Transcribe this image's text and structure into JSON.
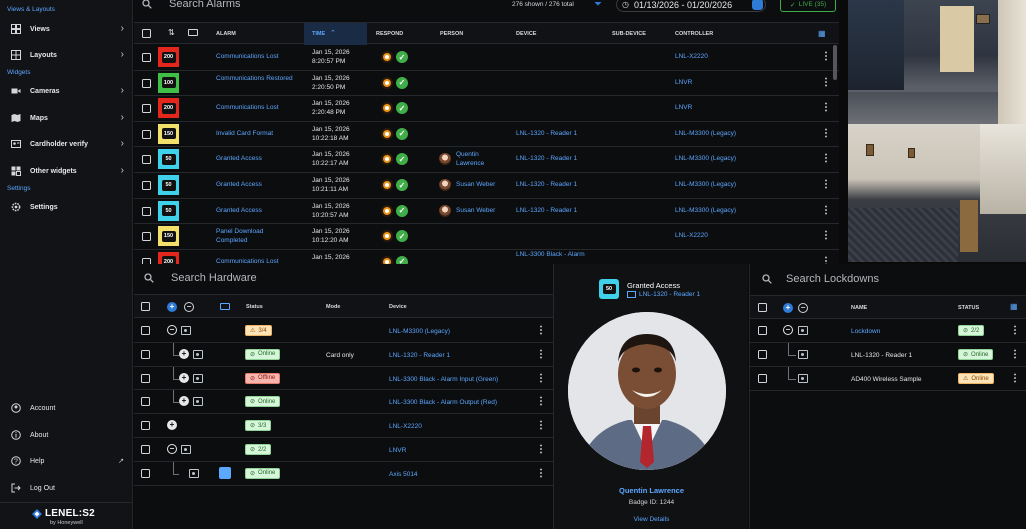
{
  "sidebar": {
    "sections": {
      "views": "Views & Layouts",
      "widgets": "Widgets",
      "settings": "Settings"
    },
    "items": [
      {
        "label": "Views",
        "icon": "views-grid-icon"
      },
      {
        "label": "Layouts",
        "icon": "layouts-icon"
      },
      {
        "label": "Cameras",
        "icon": "camera-icon"
      },
      {
        "label": "Maps",
        "icon": "map-icon"
      },
      {
        "label": "Cardholder verify",
        "icon": "id-card-icon"
      },
      {
        "label": "Other widgets",
        "icon": "widgets-icon"
      },
      {
        "label": "Settings",
        "icon": "gear-icon"
      }
    ],
    "bottom": [
      {
        "label": "Account",
        "icon": "account-icon"
      },
      {
        "label": "About",
        "icon": "info-icon"
      },
      {
        "label": "Help",
        "icon": "help-icon"
      },
      {
        "label": "Log Out",
        "icon": "logout-icon"
      }
    ],
    "brand": {
      "name": "LENEL:S2",
      "sub": "by Honeywell"
    }
  },
  "alarms": {
    "search_placeholder": "Search Alarms",
    "shown_count": "276 shown / 276 total",
    "date_range": "01/13/2026 - 01/20/2026",
    "live_label": "LIVE (35)",
    "columns": {
      "alarm": "ALARM",
      "time": "TIME",
      "respond": "RESPOND",
      "person": "PERSON",
      "device": "DEVICE",
      "subdevice": "SUB-DEVICE",
      "controller": "CONTROLLER"
    },
    "rows": [
      {
        "priority": "200",
        "color": "#e3271c",
        "alarm": "Communications Lost",
        "date": "Jan 15, 2026",
        "time": "8:20:57 PM",
        "person": "",
        "device": "",
        "controller": "LNL-X2220"
      },
      {
        "priority": "100",
        "color": "#3fbf46",
        "alarm": "Communications Restored",
        "date": "Jan 15, 2026",
        "time": "2:20:50 PM",
        "person": "",
        "device": "",
        "controller": "LNVR"
      },
      {
        "priority": "200",
        "color": "#e3271c",
        "alarm": "Communications Lost",
        "date": "Jan 15, 2026",
        "time": "2:20:48 PM",
        "person": "",
        "device": "",
        "controller": "LNVR"
      },
      {
        "priority": "150",
        "color": "#f3e06a",
        "alarm": "Invalid Card Format",
        "date": "Jan 15, 2026",
        "time": "10:22:18 AM",
        "person": "",
        "device": "LNL-1320 - Reader 1",
        "controller": "LNL-M3300 (Legacy)"
      },
      {
        "priority": "50",
        "color": "#3fd0ea",
        "alarm": "Granted Access",
        "date": "Jan 15, 2026",
        "time": "10:22:17 AM",
        "person": "Quentin Lawrence",
        "device": "LNL-1320 - Reader 1",
        "controller": "LNL-M3300 (Legacy)"
      },
      {
        "priority": "50",
        "color": "#3fd0ea",
        "alarm": "Granted Access",
        "date": "Jan 15, 2026",
        "time": "10:21:11 AM",
        "person": "Susan Weber",
        "device": "LNL-1320 - Reader 1",
        "controller": "LNL-M3300 (Legacy)"
      },
      {
        "priority": "50",
        "color": "#3fd0ea",
        "alarm": "Granted Access",
        "date": "Jan 15, 2026",
        "time": "10:20:57 AM",
        "person": "Susan Weber",
        "device": "LNL-1320 - Reader 1",
        "controller": "LNL-M3300 (Legacy)"
      },
      {
        "priority": "150",
        "color": "#f3e06a",
        "alarm": "Panel Download Completed",
        "date": "Jan 15, 2026",
        "time": "10:12:20 AM",
        "person": "",
        "device": "",
        "controller": "LNL-X2220"
      },
      {
        "priority": "200",
        "color": "#e3271c",
        "alarm": "Communications Lost",
        "date": "Jan 15, 2026",
        "time": "",
        "person": "",
        "device": "LNL-3300 Black - Alarm",
        "controller": ""
      }
    ]
  },
  "hardware": {
    "search_placeholder": "Search Hardware",
    "columns": {
      "status": "Status",
      "mode": "Mode",
      "device": "Device"
    },
    "rows": [
      {
        "status": "3/4",
        "status_kind": "warn",
        "mode": "",
        "device": "LNL-M3300 (Legacy)"
      },
      {
        "status": "Online",
        "status_kind": "ok",
        "mode": "Card only",
        "device": "LNL-1320 - Reader 1"
      },
      {
        "status": "Offline",
        "status_kind": "bad",
        "mode": "",
        "device": "LNL-3300 Black - Alarm Input (Green)"
      },
      {
        "status": "Online",
        "status_kind": "ok",
        "mode": "",
        "device": "LNL-3300 Black - Alarm Output (Red)"
      },
      {
        "status": "3/3",
        "status_kind": "ok",
        "mode": "",
        "device": "LNL-X2220"
      },
      {
        "status": "2/2",
        "status_kind": "ok",
        "mode": "",
        "device": "LNVR"
      },
      {
        "status": "Online",
        "status_kind": "ok",
        "mode": "",
        "device": "Axis 5014"
      }
    ]
  },
  "verify": {
    "badge_num": "50",
    "event": "Granted Access",
    "reader": "LNL-1320 - Reader 1",
    "name": "Quentin Lawrence",
    "badge_id": "Badge ID: 1244",
    "view_details": "View Details"
  },
  "lockdowns": {
    "search_placeholder": "Search Lockdowns",
    "columns": {
      "name": "NAME",
      "status": "STATUS"
    },
    "rows": [
      {
        "name": "Lockdown",
        "status": "2/2",
        "status_kind": "ok"
      },
      {
        "name": "LNL-1320 - Reader 1",
        "status": "Online",
        "status_kind": "ok"
      },
      {
        "name": "AD400 Wireless Sample",
        "status": "Online",
        "status_kind": "warn"
      }
    ]
  }
}
